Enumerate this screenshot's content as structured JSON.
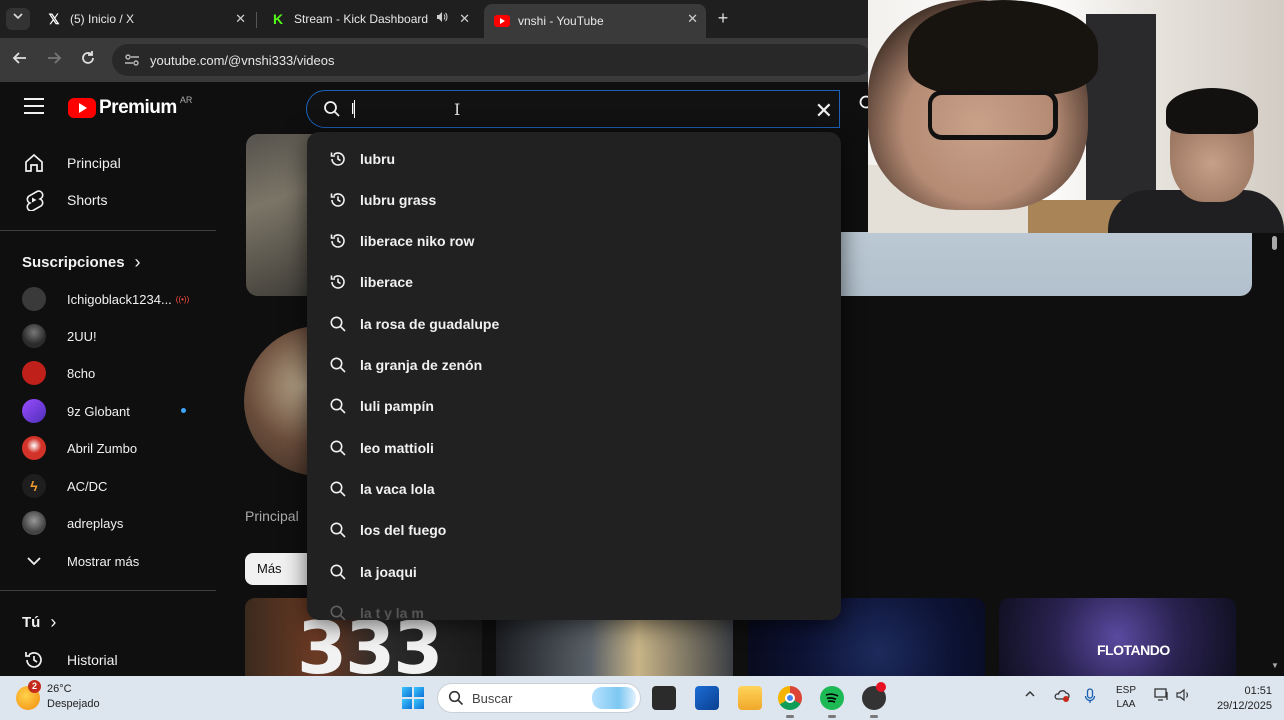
{
  "browser": {
    "tabs": [
      {
        "title": "(5) Inicio / X",
        "favicon": "x-logo-icon",
        "close": "✕"
      },
      {
        "title": "Stream - Kick Dashboard",
        "favicon": "kick-logo-icon",
        "speaker": "🔊",
        "close": "✕"
      },
      {
        "title": "vnshi - YouTube",
        "favicon": "youtube-logo-icon",
        "close": "✕",
        "active": true
      }
    ],
    "new_tab": "+",
    "url": "youtube.com/@vnshi333/videos"
  },
  "youtube": {
    "brand": "Premium",
    "country_code": "AR",
    "search": {
      "value": "l",
      "clear": "✕",
      "suggestions": [
        {
          "text": "lubru",
          "kind": "history"
        },
        {
          "text": "lubru grass",
          "kind": "history"
        },
        {
          "text": "liberace niko row",
          "kind": "history"
        },
        {
          "text": "liberace",
          "kind": "history"
        },
        {
          "text": "la rosa de guadalupe",
          "kind": "search"
        },
        {
          "text": "la granja de zenón",
          "kind": "search"
        },
        {
          "text": "luli pampín",
          "kind": "search"
        },
        {
          "text": "leo mattioli",
          "kind": "search"
        },
        {
          "text": "la vaca lola",
          "kind": "search"
        },
        {
          "text": "los del fuego",
          "kind": "search"
        },
        {
          "text": "la joaqui",
          "kind": "search"
        },
        {
          "text": "la t y la m",
          "kind": "search"
        }
      ]
    },
    "sidebar": {
      "main": [
        {
          "label": "Principal",
          "icon": "home-icon"
        },
        {
          "label": "Shorts",
          "icon": "shorts-icon"
        }
      ],
      "subscriptions_heading": "Suscripciones",
      "subscriptions_chevron": "›",
      "subscriptions": [
        {
          "label": "Ichigoblack1234...",
          "live": "((•))",
          "color": "#3a3a3a"
        },
        {
          "label": "2UU!",
          "color": "#2b2b2b"
        },
        {
          "label": "8cho",
          "color": "#c0201a"
        },
        {
          "label": "9z Globant",
          "color": "#6a3ad1",
          "new_content": true
        },
        {
          "label": "Abril Zumbo",
          "color": "#d23228"
        },
        {
          "label": "AC/DC",
          "color": "#1e1e1e"
        },
        {
          "label": "adreplays",
          "color": "#555555"
        }
      ],
      "show_more": "Mostrar más",
      "you_heading": "Tú",
      "you_chevron": "›",
      "history": "Historial"
    },
    "channel": {
      "tab_principal": "Principal",
      "chip_label": "Más recientes"
    },
    "video_thumbs": [
      {
        "text": "333"
      },
      {
        "text": ""
      },
      {
        "text": ""
      },
      {
        "text": "FLOTANDO"
      }
    ]
  },
  "taskbar": {
    "weather_temp": "26°C",
    "weather_desc": "Despejado",
    "weather_badge": "2",
    "search_placeholder": "Buscar",
    "lang_line1": "ESP",
    "lang_line2": "LAA",
    "time": "01:51",
    "date": "29/12/2025"
  },
  "colors": {
    "youtube_red": "#ff0000",
    "search_focus": "#1c62b9",
    "dropdown_bg": "#212121",
    "page_bg": "#0f0f0f"
  }
}
